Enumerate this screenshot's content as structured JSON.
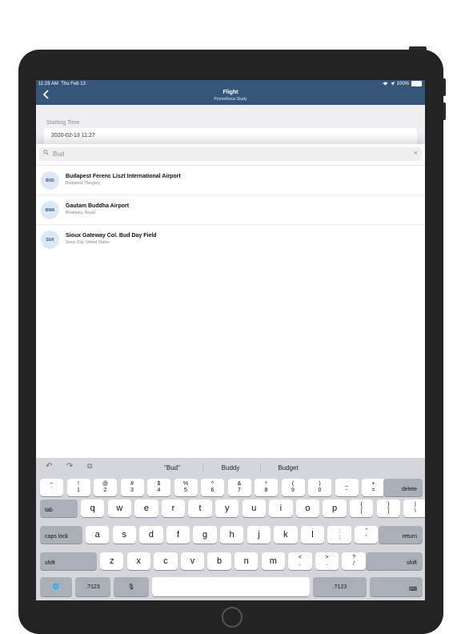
{
  "status": {
    "time": "11:28 AM",
    "date": "Thu Feb 13",
    "battery": "100%"
  },
  "nav": {
    "title": "Flight",
    "subtitle": "Prometheus Study",
    "back_icon": "chevron-left-icon"
  },
  "form": {
    "starting_time_label": "Starting Time",
    "starting_time_value": "2020-02-13 11:27"
  },
  "search": {
    "value": "Bud",
    "clear_label": "×"
  },
  "results": [
    {
      "code": "BUD",
      "name": "Budapest Ferenc Liszt International Airport",
      "location": "Budapest, Hungary"
    },
    {
      "code": "BWA",
      "name": "Gautam Buddha Airport",
      "location": "Bhairawa, Nepal"
    },
    {
      "code": "SUX",
      "name": "Sioux Gateway Col. Bud Day Field",
      "location": "Sioux City, United States"
    }
  ],
  "keyboard": {
    "suggestions": [
      "\"Bud\"",
      "Buddy",
      "Budget"
    ],
    "icons": {
      "undo": "↶",
      "redo": "↷",
      "paste": "⧉",
      "globe": "🌐",
      "mic": "🎙",
      "hide": "⌨"
    },
    "row1": [
      {
        "top": "~",
        "bot": "`"
      },
      {
        "top": "!",
        "bot": "1"
      },
      {
        "top": "@",
        "bot": "2"
      },
      {
        "top": "#",
        "bot": "3"
      },
      {
        "top": "$",
        "bot": "4"
      },
      {
        "top": "%",
        "bot": "5"
      },
      {
        "top": "^",
        "bot": "6"
      },
      {
        "top": "&",
        "bot": "7"
      },
      {
        "top": "*",
        "bot": "8"
      },
      {
        "top": "(",
        "bot": "9"
      },
      {
        "top": ")",
        "bot": "0"
      },
      {
        "top": "_",
        "bot": "-"
      },
      {
        "top": "+",
        "bot": "="
      }
    ],
    "delete": "delete",
    "tab": "tab",
    "row2": [
      "q",
      "w",
      "e",
      "r",
      "t",
      "y",
      "u",
      "i",
      "o",
      "p"
    ],
    "row2_extra": [
      {
        "top": "{",
        "bot": "["
      },
      {
        "top": "}",
        "bot": "]"
      },
      {
        "top": "|",
        "bot": "\\"
      }
    ],
    "caps": "caps lock",
    "row3": [
      "a",
      "s",
      "d",
      "f",
      "g",
      "h",
      "j",
      "k",
      "l"
    ],
    "row3_extra": [
      {
        "top": ":",
        "bot": ";"
      },
      {
        "top": "\"",
        "bot": "'"
      }
    ],
    "return": "return",
    "shift": "shift",
    "row4": [
      "z",
      "x",
      "c",
      "v",
      "b",
      "n",
      "m"
    ],
    "row4_extra": [
      {
        "top": "<",
        "bot": ","
      },
      {
        "top": ">",
        "bot": "."
      },
      {
        "top": "?",
        "bot": "/"
      }
    ],
    "numbers": ".?123"
  }
}
